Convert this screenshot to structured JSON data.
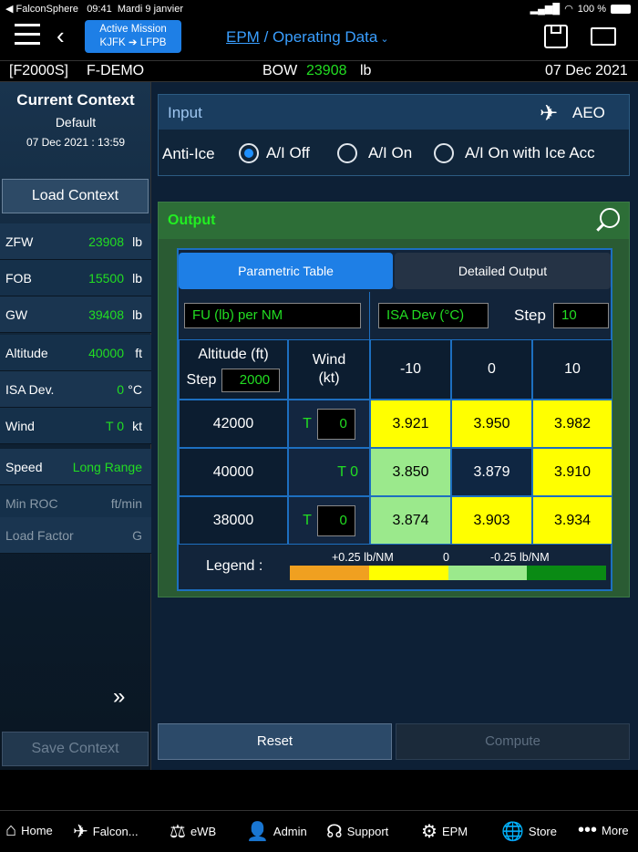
{
  "status": {
    "carrier": "FalconSphere",
    "time": "09:41",
    "date": "Mardi 9 janvier",
    "battery": "100 %"
  },
  "nav": {
    "mission_title": "Active Mission",
    "mission_route": "KJFK ➔ LFPB",
    "epm": "EPM",
    "section": "/ Operating Data"
  },
  "info": {
    "aircraft": "[F2000S]",
    "registration": "F-DEMO",
    "bow_label": "BOW",
    "bow_value": "23908",
    "bow_unit": "lb",
    "date": "07 Dec 2021"
  },
  "side": {
    "title": "Current Context",
    "sub": "Default",
    "datetime": "07 Dec 2021 : 13:59",
    "load_btn": "Load Context",
    "save_btn": "Save Context",
    "rows": [
      {
        "label": "ZFW",
        "value": "23908",
        "unit": "lb"
      },
      {
        "label": "FOB",
        "value": "15500",
        "unit": "lb"
      },
      {
        "label": "GW",
        "value": "39408",
        "unit": "lb"
      },
      {
        "label": "Altitude",
        "value": "40000",
        "unit": "ft"
      },
      {
        "label": "ISA Dev.",
        "value": "0",
        "unit": "°C"
      },
      {
        "label": "Wind",
        "value": "T 0",
        "unit": "kt"
      },
      {
        "label": "Speed",
        "value": "Long Range",
        "unit": ""
      },
      {
        "label": "Min ROC",
        "value": "",
        "unit": "ft/min"
      },
      {
        "label": "Load Factor",
        "value": "",
        "unit": "G"
      }
    ]
  },
  "input": {
    "title": "Input",
    "mode": "AEO",
    "anti_ice_label": "Anti-Ice",
    "options": [
      "A/I Off",
      "A/I On",
      "A/I On with Ice Acc"
    ],
    "selected": "A/I Off"
  },
  "output": {
    "title": "Output",
    "tabs": [
      "Parametric Table",
      "Detailed Output"
    ],
    "fu_field": "FU (lb) per NM",
    "isa_field": "ISA Dev (°C)",
    "step_label": "Step",
    "step_value": "10",
    "alt_header": "Altitude (ft)",
    "alt_step_label": "Step",
    "alt_step": "2000",
    "wind_header": "Wind\n(kt)",
    "cols": [
      "-10",
      "0",
      "10"
    ],
    "rows": [
      {
        "alt": "42000",
        "wind_t": "T",
        "wind": "0",
        "vals": [
          "3.921",
          "3.950",
          "3.982"
        ]
      },
      {
        "alt": "40000",
        "wind_t": "T 0",
        "wind": "",
        "vals": [
          "3.850",
          "3.879",
          "3.910"
        ]
      },
      {
        "alt": "38000",
        "wind_t": "T",
        "wind": "0",
        "vals": [
          "3.874",
          "3.903",
          "3.934"
        ]
      }
    ],
    "legend_label": "Legend :",
    "legend_plus": "+0.25 lb/NM",
    "legend_zero": "0",
    "legend_minus": "-0.25 lb/NM"
  },
  "buttons": {
    "reset": "Reset",
    "compute": "Compute"
  },
  "tabbar": [
    "Home",
    "Falcon...",
    "eWB",
    "Admin",
    "Support",
    "EPM",
    "Store",
    "More"
  ]
}
